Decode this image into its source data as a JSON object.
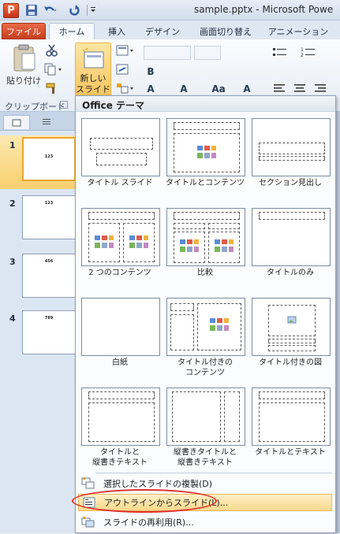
{
  "titlebar": {
    "app_letter": "P",
    "document_title": "sample.pptx - Microsoft Powe"
  },
  "ribbon_tabs": {
    "file": "ファイル",
    "home": "ホーム",
    "insert": "挿入",
    "design": "デザイン",
    "transitions": "画面切り替え",
    "animations": "アニメーション"
  },
  "clipboard": {
    "paste": "貼り付け",
    "group_label": "クリップボード"
  },
  "new_slide": {
    "line1": "新しい",
    "line2": "スライド"
  },
  "slides_pane": {
    "numbers": [
      "1",
      "2",
      "3",
      "4"
    ],
    "slide_texts": [
      "123",
      "123",
      "456",
      "789"
    ]
  },
  "gallery": {
    "header": "Office テーマ",
    "layouts": [
      "タイトル スライド",
      "タイトルとコンテンツ",
      "セクション見出し",
      "2 つのコンテンツ",
      "比較",
      "タイトルのみ",
      "白紙",
      "タイトル付きの\nコンテンツ",
      "タイトル付きの図",
      "タイトルと\n縦書きテキスト",
      "縦書きタイトルと\n縦書きテキスト",
      "タイトルとテキスト"
    ]
  },
  "menu": {
    "duplicate": "選択したスライドの複製(D)",
    "from_outline": "アウトラインからスライド(L)...",
    "reuse": "スライドの再利用(R)..."
  },
  "colors": {
    "accent_highlight": "#f8cf6e",
    "file_tab": "#c63f1c",
    "annotation_circle": "#e0302a"
  }
}
